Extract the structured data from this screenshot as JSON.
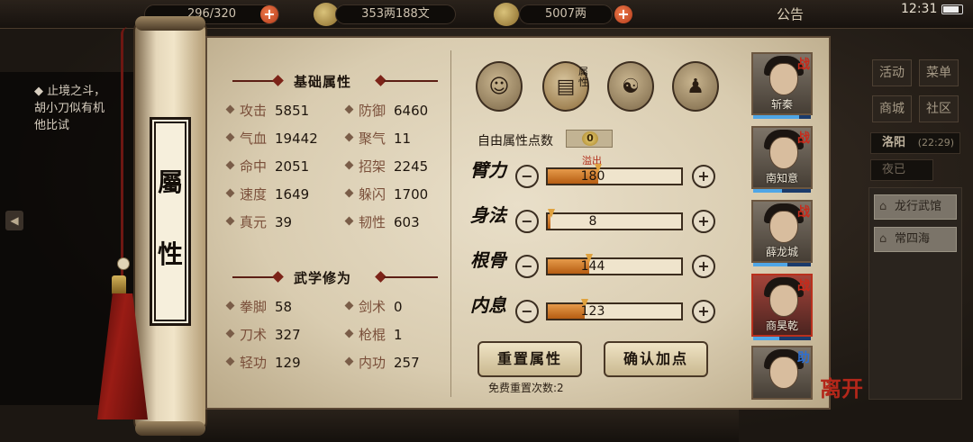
{
  "topbar": {
    "stamina": "296/320",
    "silver": "353两188文",
    "gold": "5007两",
    "announcement": "公告",
    "time": "12:31"
  },
  "quest": {
    "title": "◆ 止境之斗，",
    "line2": "胡小刀似有机",
    "line3": "他比试"
  },
  "right_menu": {
    "activity": "活动",
    "menu": "菜单",
    "shop": "商城",
    "community": "社区",
    "location": "洛阳",
    "location_time": "(22:29)",
    "dusk": "夜已",
    "places": [
      "龙行武馆",
      "常四海"
    ]
  },
  "scroll_title": [
    "屬",
    "性"
  ],
  "basic_section": {
    "title": "基础属性",
    "stats": [
      {
        "label": "攻击",
        "value": "5851"
      },
      {
        "label": "防御",
        "value": "6460"
      },
      {
        "label": "气血",
        "value": "19442"
      },
      {
        "label": "聚气",
        "value": "11"
      },
      {
        "label": "命中",
        "value": "2051"
      },
      {
        "label": "招架",
        "value": "2245"
      },
      {
        "label": "速度",
        "value": "1649"
      },
      {
        "label": "躲闪",
        "value": "1700"
      },
      {
        "label": "真元",
        "value": "39"
      },
      {
        "label": "韧性",
        "value": "603"
      }
    ]
  },
  "martial_section": {
    "title": "武学修为",
    "stats": [
      {
        "label": "拳脚",
        "value": "58"
      },
      {
        "label": "剑术",
        "value": "0"
      },
      {
        "label": "刀术",
        "value": "327"
      },
      {
        "label": "枪棍",
        "value": "1"
      },
      {
        "label": "轻功",
        "value": "129"
      },
      {
        "label": "内功",
        "value": "257"
      }
    ]
  },
  "tabs": {
    "attr_tag": "属性",
    "icons": [
      "hero-icon",
      "attribute-book-icon",
      "taiji-icon",
      "meridian-icon"
    ]
  },
  "free_points": {
    "label": "自由属性点数",
    "value": "0"
  },
  "overflow_label": "溢出",
  "attributes": [
    {
      "name": "臂力",
      "value": "180",
      "fill": 0.38
    },
    {
      "name": "身法",
      "value": "8",
      "fill": 0.02
    },
    {
      "name": "根骨",
      "value": "144",
      "fill": 0.31
    },
    {
      "name": "内息",
      "value": "123",
      "fill": 0.28
    }
  ],
  "buttons": {
    "reset": "重置属性",
    "confirm": "确认加点",
    "reset_note": "免费重置次数:2"
  },
  "roster": [
    {
      "name": "斩秦",
      "role": "战",
      "exp": 0.8
    },
    {
      "name": "南知意",
      "role": "战",
      "exp": 0.5
    },
    {
      "name": "薛龙城",
      "role": "战",
      "exp": 0.6
    },
    {
      "name": "商昊乾",
      "role": "战",
      "exp": 0.45
    },
    {
      "name": "",
      "role": "助",
      "exp": 0.3
    }
  ],
  "leave_label": "离开",
  "colors": {
    "accent_red": "#b3271a",
    "bar_fill": "#d9822b",
    "paper": "#e4d9c0"
  }
}
